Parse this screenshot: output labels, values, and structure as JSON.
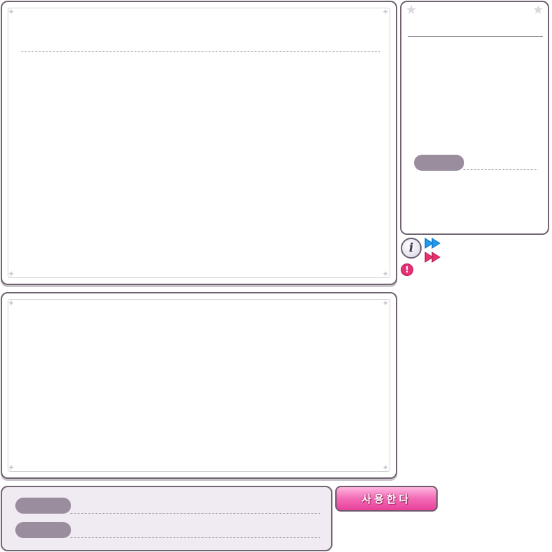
{
  "use_button": {
    "label": "사용한다"
  },
  "icons": {
    "info": "info-icon",
    "warning": "warning-icon",
    "fast_forward_blue": "fast-forward-blue-icon",
    "fast_forward_pink": "fast-forward-pink-icon"
  },
  "info_icon_glyph": "i",
  "warning_icon_glyph": "!",
  "colors": {
    "frame_border": "#6f6470",
    "pill": "#9a8d9e",
    "button_pink": "#f26ab4",
    "ff_blue": "#1e9bf0",
    "ff_pink": "#e8316f",
    "bottom_panel_bg": "#f0ebf2"
  }
}
